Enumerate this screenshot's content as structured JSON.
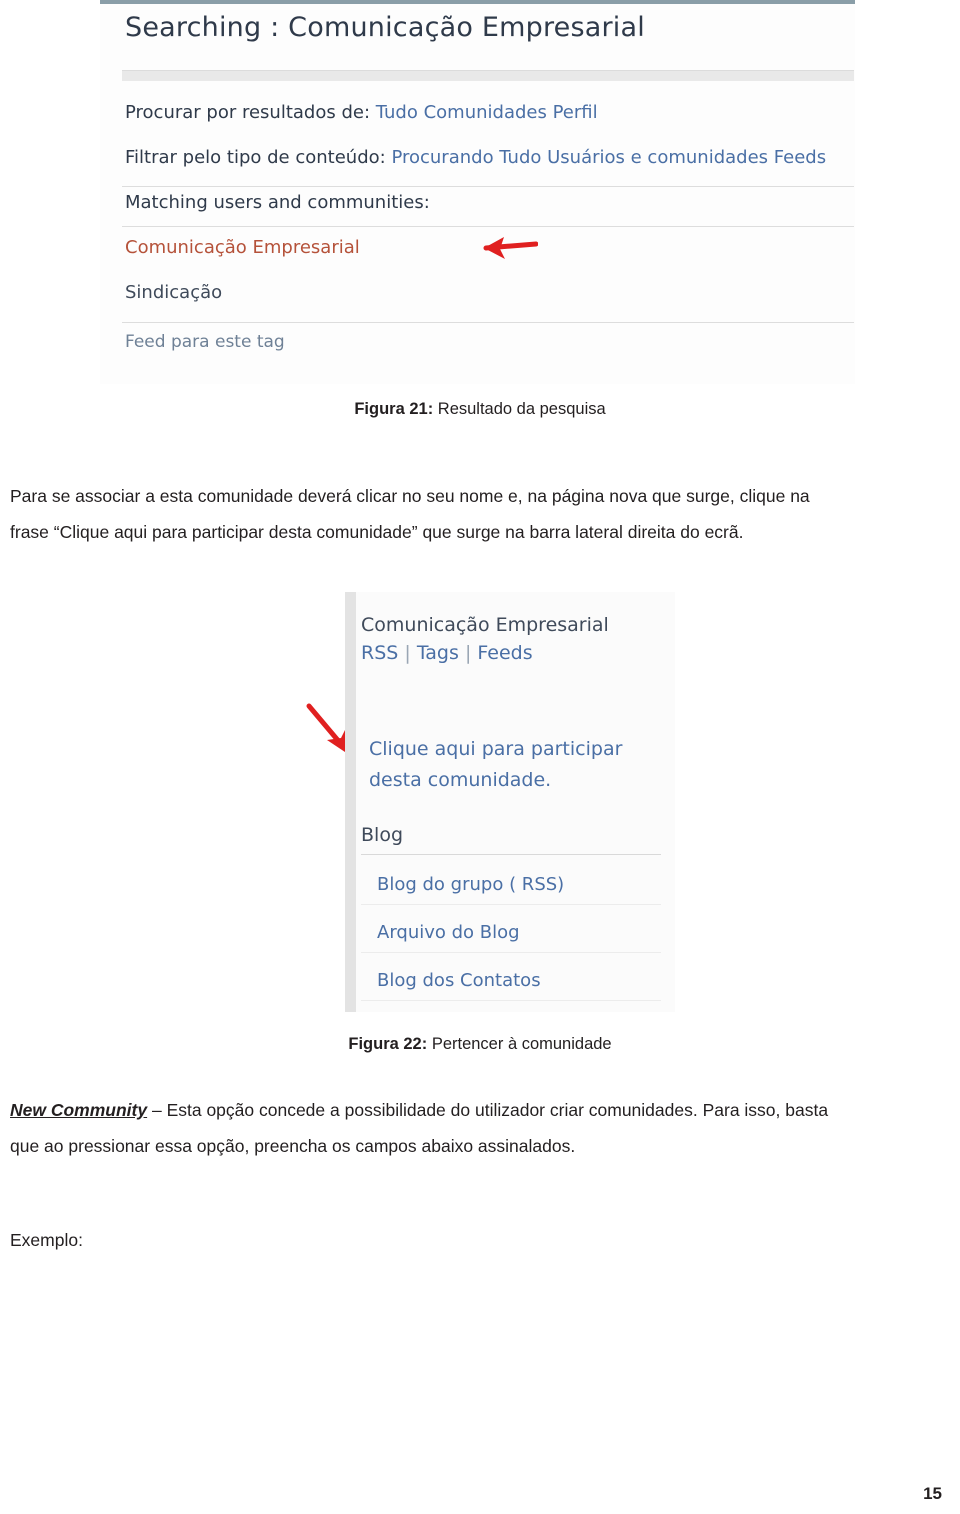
{
  "page": {
    "number": "15"
  },
  "screenshot1": {
    "title": "Searching : Comunicação Empresarial",
    "row_search_label": "Procurar por resultados de:",
    "row_search_links": "Tudo Comunidades Perfil",
    "row_filter_label": "Filtrar pelo tipo de conteúdo:",
    "row_filter_links": "Procurando Tudo Usuários e comunidades Feeds",
    "matching_header": "Matching users and communities:",
    "community_result": "Comunicação Empresarial",
    "syndication_header": "Sindicação",
    "feed_link": "Feed para este tag",
    "arrow_color": "#e02020"
  },
  "figure21": {
    "caption_bold": "Figura 21:",
    "caption_text": " Resultado da pesquisa"
  },
  "paragraph1": {
    "line1": "Para se associar a esta comunidade deverá clicar no seu nome e, na página nova que surge, clique na",
    "line2": "frase “Clique aqui para participar desta comunidade” que surge na barra lateral direita do ecrã."
  },
  "screenshot2": {
    "community_title": "Comunicação Empresarial",
    "nav_rss": "RSS",
    "nav_tags": "Tags",
    "nav_feeds": "Feeds",
    "nav_separator": "|",
    "cta_text": "Clique aqui para participar desta comunidade.",
    "blog_header": "Blog",
    "list_items": [
      "Blog do grupo ( RSS)",
      "Arquivo do Blog",
      "Blog dos Contatos"
    ],
    "arrow_color": "#e02020"
  },
  "figure22": {
    "caption_bold": "Figura 22:",
    "caption_text": " Pertencer à comunidade"
  },
  "paragraph2": {
    "emphasis": "New Community",
    "line1_rest": " – Esta opção concede a possibilidade do utilizador criar comunidades.  Para isso, basta",
    "line2": "que ao pressionar essa opção, preencha os campos abaixo assinalados."
  },
  "paragraph3": {
    "text": "Exemplo:"
  }
}
